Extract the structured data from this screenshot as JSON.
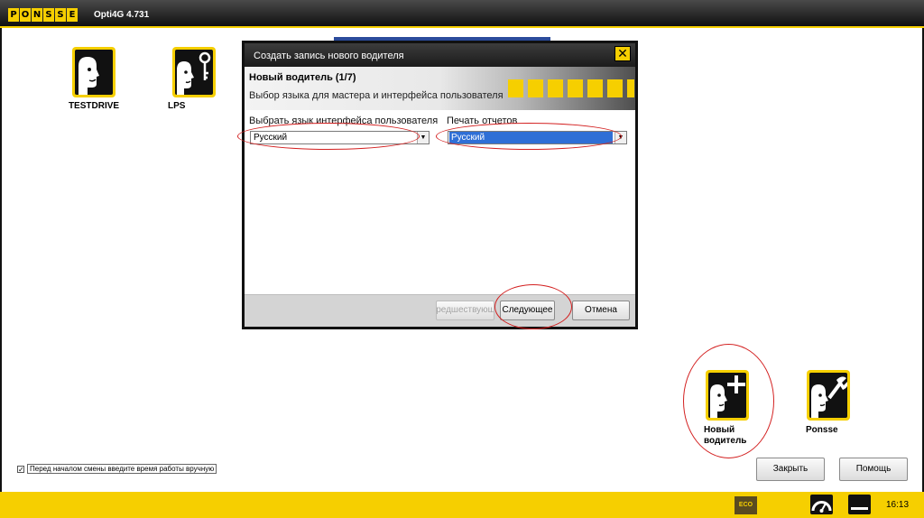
{
  "app": {
    "brand_letters": [
      "P",
      "O",
      "N",
      "S",
      "S",
      "E"
    ],
    "title": "Opti4G 4.731"
  },
  "desktop": {
    "icons": [
      {
        "label": "TESTDRIVE"
      },
      {
        "label": "LPS"
      },
      {
        "label": "Новый водитель"
      },
      {
        "label": "Ponsse"
      }
    ]
  },
  "dialog": {
    "title": "Создать запись нового водителя",
    "close_glyph": "✕",
    "step": "Новый водитель (1/7)",
    "subtitle": "Выбор языка для мастера и интерфейса пользователя",
    "ui_language": {
      "label": "Выбрать язык интерфейса пользователя",
      "value": "Русский"
    },
    "report_print": {
      "label": "Печать отчетов",
      "value": "Русский"
    },
    "buttons": {
      "previous": "Предшествующий",
      "next": "Следующее",
      "cancel": "Отмена"
    }
  },
  "footer": {
    "manual_time_checkbox": {
      "checked": true,
      "mark": "✓",
      "label": "Перед началом смены введите время работы вручную"
    },
    "close_button": "Закрыть",
    "help_button": "Помощь"
  },
  "statusbar": {
    "eco_label": "ECO",
    "time": "16:13"
  },
  "colors": {
    "accent": "#f6cf00",
    "annotation": "#d32020",
    "selection": "#2f6fd6"
  }
}
